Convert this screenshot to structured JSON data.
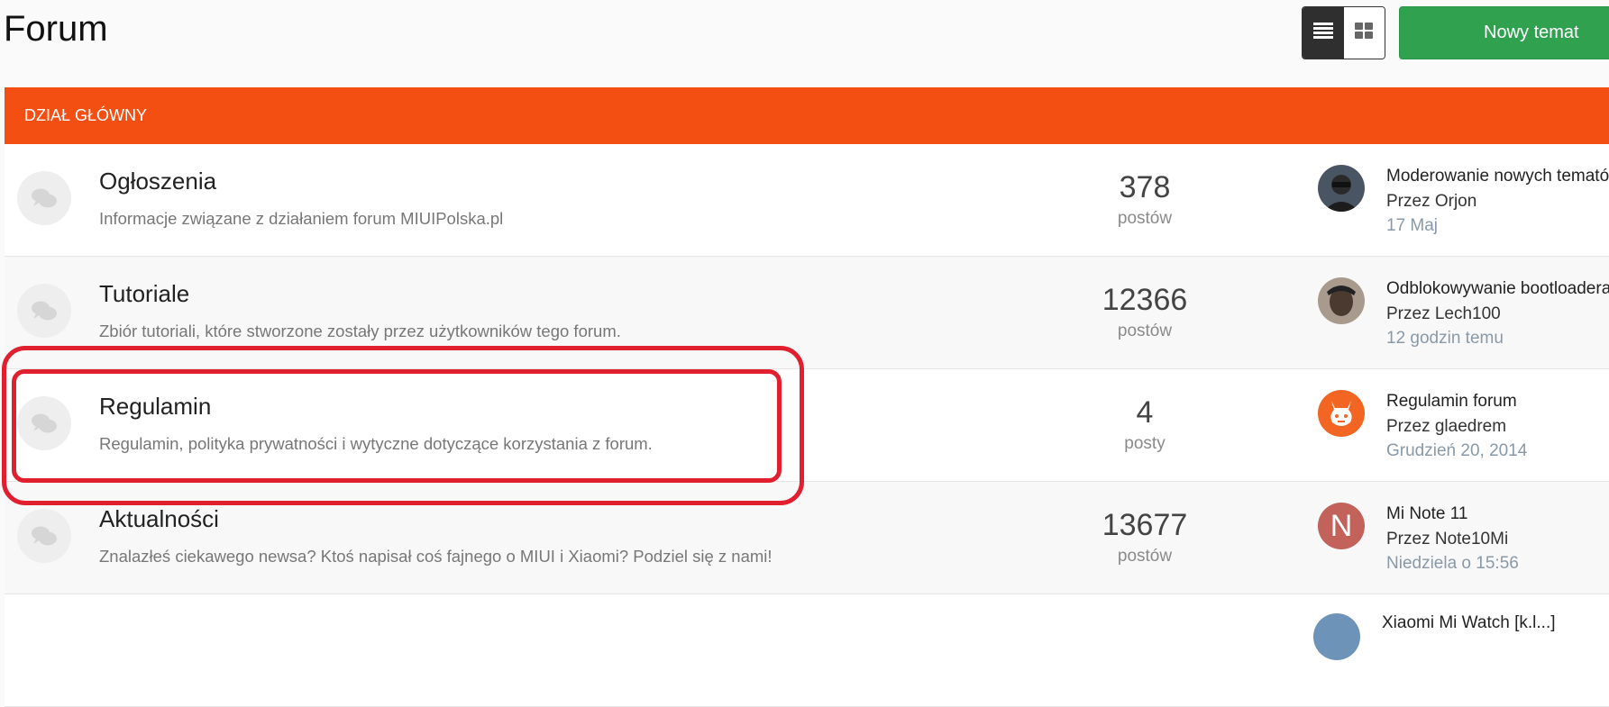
{
  "page": {
    "title": "Forum"
  },
  "toolbar": {
    "list_view_icon": "list-view-icon",
    "grid_view_icon": "grid-view-icon",
    "new_topic_label": "Nowy temat"
  },
  "colors": {
    "category_header": "#f44f12",
    "new_topic_button": "#2fa14f",
    "highlight": "#e0202e",
    "meta_date": "#8a99a8"
  },
  "category": {
    "name": "DZIAŁ GŁÓWNY",
    "forums": [
      {
        "icon": "comments-icon",
        "title": "Ogłoszenia",
        "description": "Informacje związane z działaniem forum MIUIPolska.pl",
        "count": "378",
        "count_label": "postów",
        "last_post": {
          "avatar": "user-photo-avatar",
          "title": "Moderowanie nowych tematów",
          "author": "Przez Orjon",
          "date": "17 Maj"
        }
      },
      {
        "icon": "comments-icon",
        "title": "Tutoriale",
        "description": "Zbiór tutoriali, które stworzone zostały przez użytkowników tego forum.",
        "count": "12366",
        "count_label": "postów",
        "last_post": {
          "avatar": "user-photo-avatar",
          "title": "Odblokowywanie bootloadera",
          "author": "Przez Lech100",
          "date": "12 godzin temu"
        }
      },
      {
        "icon": "comments-icon",
        "title": "Regulamin",
        "description": "Regulamin, polityka prywatności i wytyczne dotyczące korzystania z forum.",
        "count": "4",
        "count_label": "posty",
        "last_post": {
          "avatar": "mi-bunny-avatar",
          "title": "Regulamin forum",
          "author": "Przez glaedrem",
          "date": "Grudzień 20, 2014"
        }
      },
      {
        "icon": "comments-icon",
        "title": "Aktualności",
        "description": "Znalazłeś ciekawego newsa? Ktoś napisał coś fajnego o MIUI i Xiaomi? Podziel się z nami!",
        "count": "13677",
        "count_label": "postów",
        "last_post": {
          "avatar": "letter-avatar",
          "avatar_letter": "N",
          "title": "Mi Note 11",
          "author": "Przez Note10Mi",
          "date": "Niedziela o 15:56"
        }
      }
    ],
    "next_row_partial_title": "Xiaomi Mi Watch [k.l...]"
  }
}
